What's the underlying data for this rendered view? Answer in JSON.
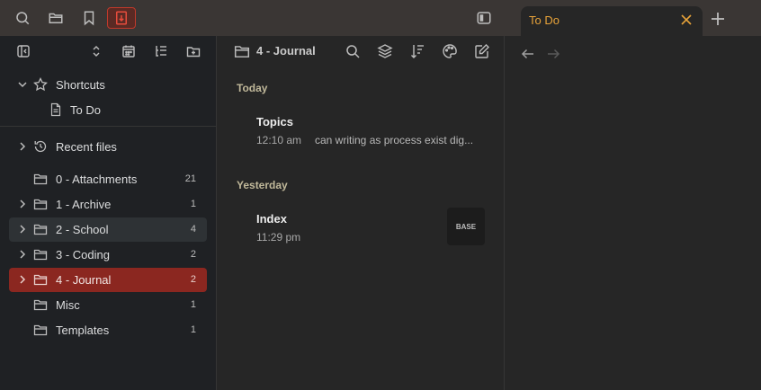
{
  "ribbon": {
    "icons": [
      "search-icon",
      "folder-icon",
      "bookmark-icon",
      "calendar-note-icon"
    ],
    "active_icon": "calendar-note-icon",
    "layout_toggle_icon": "sidebar-toggle-icon"
  },
  "tab": {
    "title": "To Do",
    "close_icon": "close-icon",
    "new_tab_icon": "plus-icon"
  },
  "colors": {
    "accent": "#e8a33a",
    "selected": "#8b2720",
    "sidebar_bg": "#1f2124",
    "main_bg": "#262626",
    "titlebar_bg": "#3a3634"
  },
  "sidebar": {
    "toolbar_icons": [
      "collapse-sidebar-icon",
      "expand-collapse-icon",
      "calendar-icon",
      "sort-tree-icon",
      "new-folder-icon"
    ],
    "shortcuts": {
      "label": "Shortcuts",
      "items": [
        {
          "label": "To Do"
        }
      ]
    },
    "recent": {
      "label": "Recent files"
    },
    "folders": [
      {
        "label": "0 - Attachments",
        "count": "21",
        "expandable": false
      },
      {
        "label": "1 - Archive",
        "count": "1",
        "expandable": true
      },
      {
        "label": "2 - School",
        "count": "4",
        "expandable": true
      },
      {
        "label": "3 - Coding",
        "count": "2",
        "expandable": true
      },
      {
        "label": "4 - Journal",
        "count": "2",
        "expandable": true
      },
      {
        "label": "Misc",
        "count": "1",
        "expandable": false
      },
      {
        "label": "Templates",
        "count": "1",
        "expandable": false
      }
    ]
  },
  "filelist": {
    "title": "4 - Journal",
    "toolbar_icons": [
      "search-icon",
      "layers-icon",
      "sort-icon",
      "palette-icon",
      "new-note-icon"
    ],
    "sections": [
      {
        "label": "Today",
        "notes": [
          {
            "title": "Topics",
            "time": "12:10 am",
            "preview": "can writing as process exist dig..."
          }
        ]
      },
      {
        "label": "Yesterday",
        "notes": [
          {
            "title": "Index",
            "time": "11:29 pm",
            "thumb": "BASE"
          }
        ]
      }
    ]
  },
  "rightpane": {
    "nav_icons": [
      "back-arrow-icon",
      "forward-arrow-icon"
    ]
  }
}
